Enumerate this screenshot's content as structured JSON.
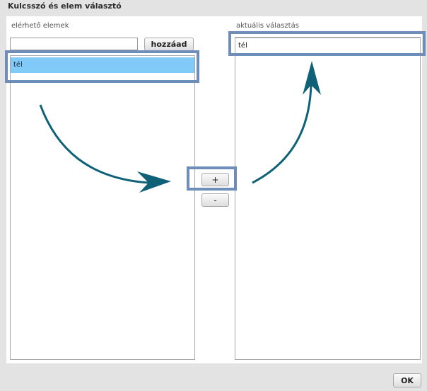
{
  "dialog": {
    "title": "Kulcsszó és elem választó"
  },
  "left": {
    "label": "elérhető elemek",
    "input_value": "",
    "add_button": "hozzáad",
    "items": [
      "tél"
    ]
  },
  "right": {
    "label": "aktuális választás",
    "items": [
      "tél"
    ]
  },
  "controls": {
    "plus": "+",
    "minus": "-",
    "ok": "OK"
  },
  "colors": {
    "selected_item": "#80c9f8",
    "highlight_box": "#6f8db9",
    "arrow": "#0e6177"
  }
}
